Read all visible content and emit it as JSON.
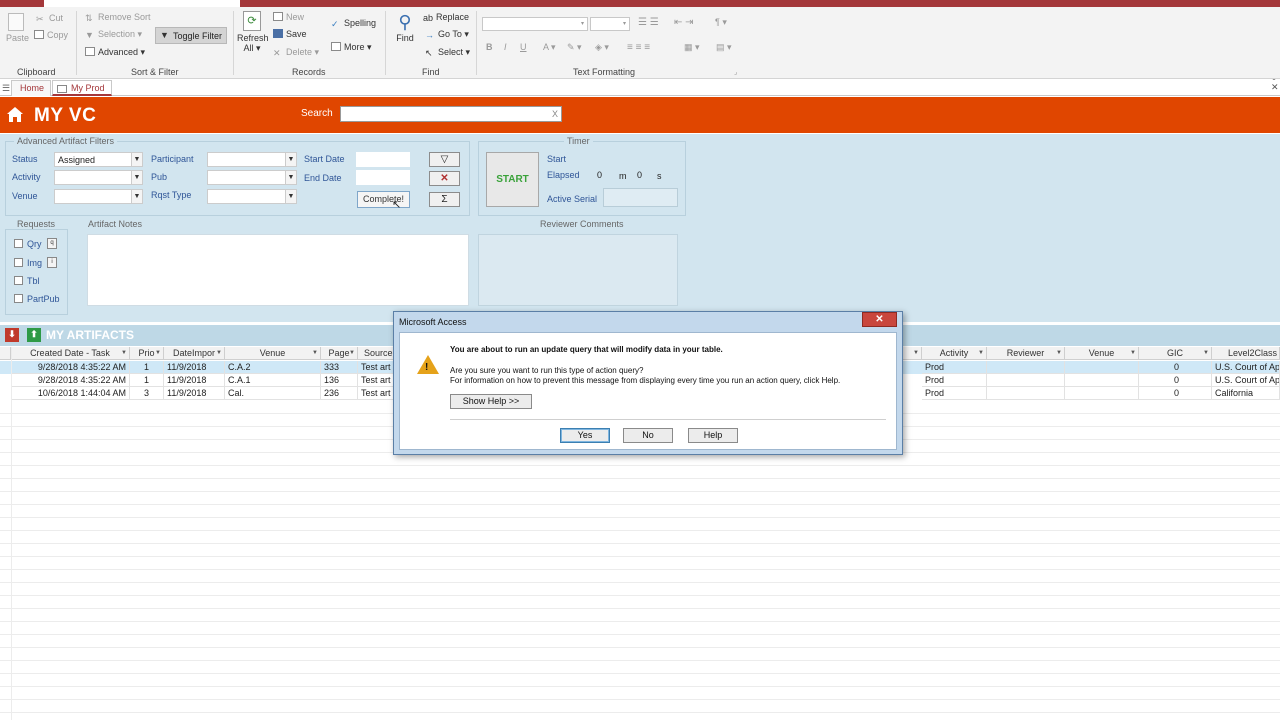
{
  "ribbon": {
    "clipboard": {
      "paste": "Paste",
      "cut": "Cut",
      "copy": "Copy",
      "group": "Clipboard"
    },
    "sortfilter": {
      "remove_sort": "Remove Sort",
      "selection": "Selection",
      "advanced": "Advanced",
      "toggle_filter": "Toggle Filter",
      "group": "Sort & Filter"
    },
    "records": {
      "refresh": "Refresh",
      "refresh2": "All",
      "new": "New",
      "save": "Save",
      "delete": "Delete",
      "spelling": "Spelling",
      "more": "More",
      "group": "Records"
    },
    "find": {
      "find": "Find",
      "replace": "Replace",
      "goto": "Go To",
      "select": "Select",
      "group": "Find"
    },
    "textformat": {
      "group": "Text Formatting",
      "bold": "B",
      "italic": "I",
      "underline": "U",
      "fontcolor": "A"
    }
  },
  "tabs": [
    {
      "label": "Home"
    },
    {
      "label": "My Prod"
    }
  ],
  "header": {
    "title": "MY VC",
    "search_label": "Search",
    "search_clear": "X",
    "search_value": ""
  },
  "filters": {
    "legend": "Advanced Artifact Filters",
    "status_label": "Status",
    "status_value": "Assigned",
    "activity_label": "Activity",
    "venue_label": "Venue",
    "participant_label": "Participant",
    "pub_label": "Pub",
    "rqst_label": "Rqst Type",
    "start_date_label": "Start Date",
    "end_date_label": "End Date",
    "complete_button": "Complete!",
    "filter_icon": "funnel-icon",
    "clear_icon": "clear-filter-icon",
    "sum_label": "Σ"
  },
  "timer": {
    "legend": "Timer",
    "start_button": "START",
    "start_label": "Start",
    "elapsed_label": "Elapsed",
    "min_value": "0",
    "min_unit": "m",
    "sec_value": "0",
    "sec_unit": "s",
    "active_serial_label": "Active Serial",
    "active_serial_value": ""
  },
  "requests": {
    "legend": "Requests",
    "items": [
      {
        "label": "Qry",
        "btn": "q"
      },
      {
        "label": "Img",
        "btn": "i"
      },
      {
        "label": "Tbl"
      },
      {
        "label": "PartPub"
      }
    ]
  },
  "notes": {
    "legend": "Artifact Notes"
  },
  "reviewer": {
    "legend": "Reviewer Comments"
  },
  "artifacts": {
    "title": "MY ARTIFACTS",
    "columns": [
      "Created Date - Task",
      "Prio",
      "DateImpor",
      "Venue",
      "Page",
      "Source",
      "Activity",
      "Reviewer",
      "Venue",
      "GIC",
      "Level2Class"
    ],
    "rows": [
      {
        "created": "9/28/2018 4:35:22 AM",
        "prio": "1",
        "dateimpor": "11/9/2018",
        "venue": "C.A.2",
        "page": "333",
        "source": "Test art",
        "activity": "Prod",
        "reviewer": "",
        "venue2": "",
        "gic": "0",
        "level2": "U.S. Court of Ap"
      },
      {
        "created": "9/28/2018 4:35:22 AM",
        "prio": "1",
        "dateimpor": "11/9/2018",
        "venue": "C.A.1",
        "page": "136",
        "source": "Test art",
        "activity": "Prod",
        "reviewer": "",
        "venue2": "",
        "gic": "0",
        "level2": "U.S. Court of Ap"
      },
      {
        "created": "10/6/2018 1:44:04 AM",
        "prio": "3",
        "dateimpor": "11/9/2018",
        "venue": "Cal.",
        "page": "236",
        "source": "Test art",
        "activity": "Prod",
        "reviewer": "",
        "venue2": "",
        "gic": "0",
        "level2": "California"
      }
    ]
  },
  "dialog": {
    "title": "Microsoft Access",
    "close": "✕",
    "heading": "You are about to run an update query that will modify data in your table.",
    "line1": "Are you sure you want to run this type of action query?",
    "line2": "For information on how to prevent this message from displaying every time you run an action query, click Help.",
    "show_help": "Show Help >>",
    "yes": "Yes",
    "no": "No",
    "help": "Help"
  },
  "colors": {
    "accent": "#e04600",
    "brand": "#a4373a",
    "form_bg": "#d2e5ef"
  }
}
